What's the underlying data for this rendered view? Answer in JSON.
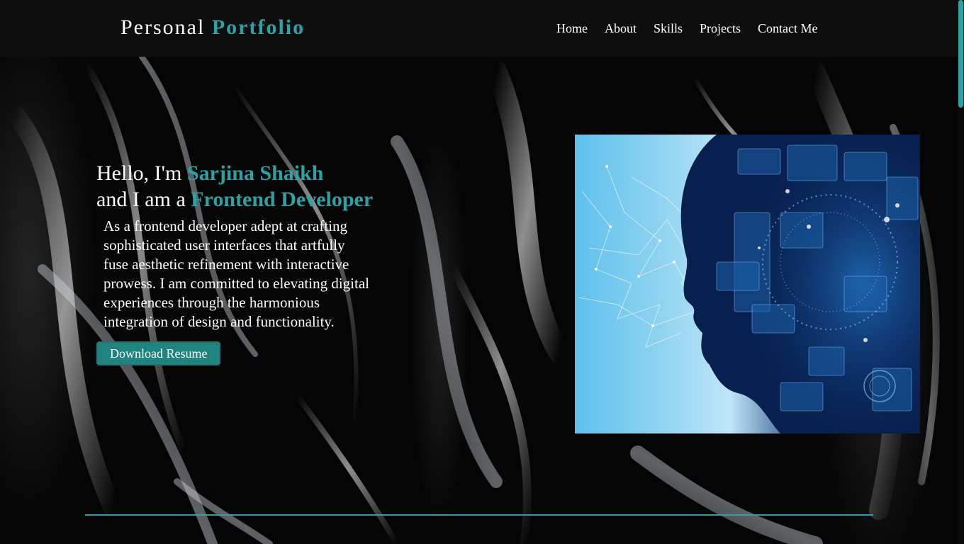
{
  "header": {
    "logo_main": "Personal",
    "logo_accent": "Portfolio",
    "nav": [
      {
        "label": "Home"
      },
      {
        "label": "About"
      },
      {
        "label": "Skills"
      },
      {
        "label": "Projects"
      },
      {
        "label": "Contact Me"
      }
    ]
  },
  "hero": {
    "greeting": "Hello, I'm",
    "name": "Sarjina Shaikh",
    "role_prefix": "and I am a",
    "role": "Frontend Developer",
    "description": "As a frontend developer adept at crafting sophisticated user interfaces that artfully fuse aesthetic refinement with interactive prowess. I am committed to elevating digital experiences through the harmonious integration of design and functionality.",
    "button_label": "Download Resume"
  },
  "theme": {
    "accent": "#2aa3a6",
    "background": "#000000",
    "header_bg": "#0e0e0e",
    "button_bg": "#1f8480"
  }
}
